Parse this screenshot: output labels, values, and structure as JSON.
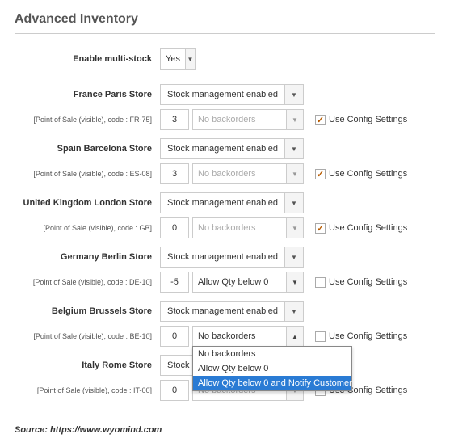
{
  "title": "Advanced Inventory",
  "enable_multi_stock": {
    "label": "Enable multi-stock",
    "value": "Yes"
  },
  "use_config_label": "Use Config Settings",
  "stores": [
    {
      "name": "France Paris Store",
      "meta": "[Point of Sale (visible), code : FR-75]",
      "stock_mgmt": "Stock management enabled",
      "qty": "3",
      "backorder": "No backorders",
      "bo_active": false,
      "use_config": true,
      "open": false
    },
    {
      "name": "Spain Barcelona Store",
      "meta": "[Point of Sale (visible), code : ES-08]",
      "stock_mgmt": "Stock management enabled",
      "qty": "3",
      "backorder": "No backorders",
      "bo_active": false,
      "use_config": true,
      "open": false
    },
    {
      "name": "United Kingdom London Store",
      "meta": "[Point of Sale (visible), code : GB]",
      "stock_mgmt": "Stock management enabled",
      "qty": "0",
      "backorder": "No backorders",
      "bo_active": false,
      "use_config": true,
      "open": false
    },
    {
      "name": "Germany Berlin Store",
      "meta": "[Point of Sale (visible), code : DE-10]",
      "stock_mgmt": "Stock management enabled",
      "qty": "-5",
      "backorder": "Allow Qty below 0",
      "bo_active": true,
      "use_config": false,
      "open": false
    },
    {
      "name": "Belgium Brussels Store",
      "meta": "[Point of Sale (visible), code : BE-10]",
      "stock_mgmt": "Stock management enabled",
      "qty": "0",
      "backorder": "No backorders",
      "bo_active": true,
      "use_config": false,
      "open": true
    },
    {
      "name": "Italy Rome Store",
      "meta": "[Point of Sale (visible), code : IT-00]",
      "stock_mgmt": "Stock management enabled",
      "qty": "0",
      "backorder": "No backorders",
      "bo_active": false,
      "use_config": false,
      "open": false
    }
  ],
  "dropdown_options": [
    "No backorders",
    "Allow Qty below 0",
    "Allow Qty below 0 and Notify Customer"
  ],
  "dropdown_highlight_index": 2,
  "source": "Source: https://www.wyomind.com"
}
